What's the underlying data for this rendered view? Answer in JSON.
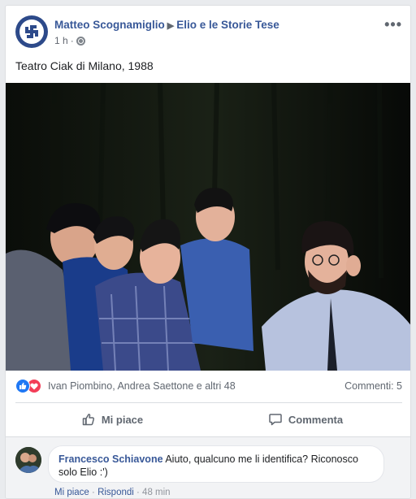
{
  "post": {
    "author": "Matteo Scognamiglio",
    "group": "Elio e le Storie Tese",
    "time": "1 h",
    "text": "Teatro Ciak di Milano, 1988",
    "more_label": "•••"
  },
  "reactions": {
    "names": "Ivan Piombino, Andrea Saettone e altri 48",
    "comments_label": "Commenti: 5"
  },
  "actions": {
    "like_label": "Mi piace",
    "comment_label": "Commenta"
  },
  "comment": {
    "author": "Francesco Schiavone",
    "text": "Aiuto, qualcuno me li identifica? Riconosco solo Elio :')",
    "like_label": "Mi piace",
    "reply_label": "Rispondi",
    "time": "48 min"
  },
  "colors": {
    "link_blue": "#385898",
    "like_blue": "#2078f4",
    "love_red": "#f33e58",
    "background": "#e9ebee"
  }
}
